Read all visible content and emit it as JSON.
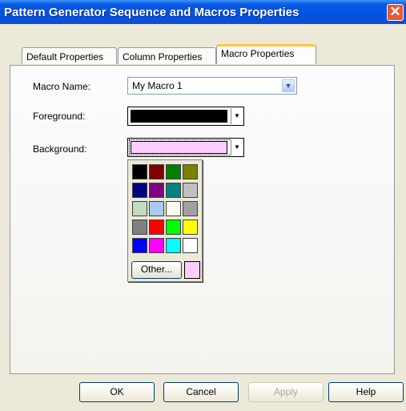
{
  "window": {
    "title": "Pattern Generator Sequence and Macros Properties"
  },
  "tabs": [
    {
      "label": "Default Properties"
    },
    {
      "label": "Column Properties"
    },
    {
      "label": "Macro Properties",
      "active": true
    }
  ],
  "form": {
    "macro_name_label": "Macro Name:",
    "macro_name_value": "My Macro 1",
    "foreground_label": "Foreground:",
    "foreground_color": "#000000",
    "background_label": "Background:",
    "background_color": "#ffccff"
  },
  "palette": {
    "colors": [
      "#000000",
      "#800000",
      "#008000",
      "#808000",
      "#000080",
      "#800080",
      "#008080",
      "#c0c0c0",
      "#c0dcc0",
      "#a6caf0",
      "#fffbf0",
      "#a0a0a4",
      "#808080",
      "#ff0000",
      "#00ff00",
      "#ffff00",
      "#0000ff",
      "#ff00ff",
      "#00ffff",
      "#ffffff"
    ],
    "other_label": "Other...",
    "current_color": "#ffccff"
  },
  "buttons": {
    "ok": "OK",
    "cancel": "Cancel",
    "apply": "Apply",
    "help": "Help"
  }
}
